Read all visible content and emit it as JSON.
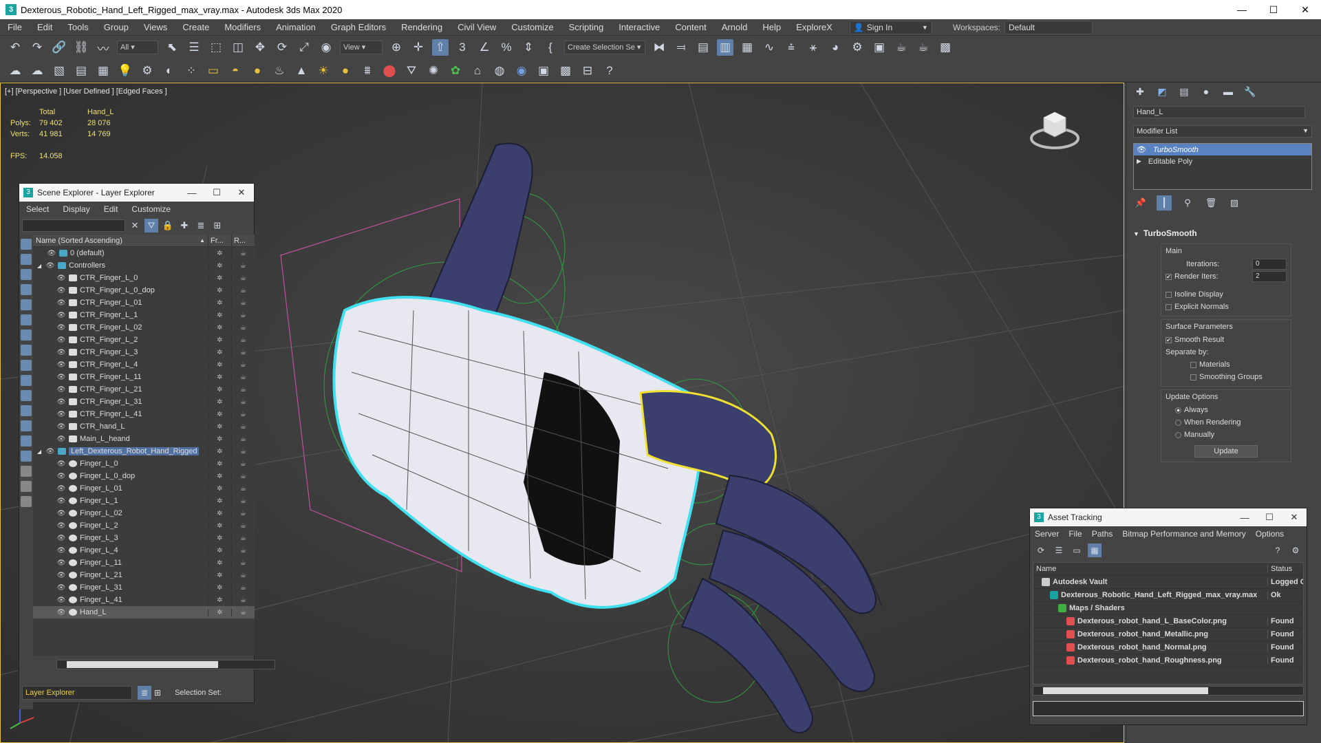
{
  "window": {
    "title": "Dexterous_Robotic_Hand_Left_Rigged_max_vray.max - Autodesk 3ds Max 2020",
    "minimize": "—",
    "maximize": "☐",
    "close": "✕"
  },
  "menubar": {
    "items": [
      "File",
      "Edit",
      "Tools",
      "Group",
      "Views",
      "Create",
      "Modifiers",
      "Animation",
      "Graph Editors",
      "Rendering",
      "Civil View",
      "Customize",
      "Scripting",
      "Interactive",
      "Content",
      "Arnold",
      "Help",
      "ExploreX"
    ],
    "sign_in": "Sign In",
    "workspaces_label": "Workspaces:",
    "workspace_value": "Default"
  },
  "toolbar1": {
    "selection_filter": "All",
    "ref_coord": "View",
    "create_selection_set": "Create Selection Se"
  },
  "viewport": {
    "label": "[+] [Perspective ] [User Defined ] [Edged Faces ]",
    "stats": {
      "col_total": "Total",
      "col_object": "Hand_L",
      "polys_label": "Polys:",
      "polys_total": "79 402",
      "polys_object": "28 076",
      "verts_label": "Verts:",
      "verts_total": "41 981",
      "verts_object": "14 769",
      "fps_label": "FPS:",
      "fps_value": "14.058"
    }
  },
  "scene_explorer": {
    "title": "Scene Explorer - Layer Explorer",
    "menu": [
      "Select",
      "Display",
      "Edit",
      "Customize"
    ],
    "columns": {
      "name": "Name (Sorted Ascending)",
      "freeze": "Fr...",
      "render": "R..."
    },
    "rows": [
      {
        "label": "0 (default)",
        "indent": 1,
        "kind": "layer"
      },
      {
        "label": "Controllers",
        "indent": 0,
        "kind": "group"
      },
      {
        "label": "CTR_Finger_L_0",
        "indent": 2,
        "kind": "ctrl"
      },
      {
        "label": "CTR_Finger_L_0_dop",
        "indent": 2,
        "kind": "ctrl"
      },
      {
        "label": "CTR_Finger_L_01",
        "indent": 2,
        "kind": "ctrl"
      },
      {
        "label": "CTR_Finger_L_1",
        "indent": 2,
        "kind": "ctrl"
      },
      {
        "label": "CTR_Finger_L_02",
        "indent": 2,
        "kind": "ctrl"
      },
      {
        "label": "CTR_Finger_L_2",
        "indent": 2,
        "kind": "ctrl"
      },
      {
        "label": "CTR_Finger_L_3",
        "indent": 2,
        "kind": "ctrl"
      },
      {
        "label": "CTR_Finger_L_4",
        "indent": 2,
        "kind": "ctrl"
      },
      {
        "label": "CTR_Finger_L_11",
        "indent": 2,
        "kind": "ctrl"
      },
      {
        "label": "CTR_Finger_L_21",
        "indent": 2,
        "kind": "ctrl"
      },
      {
        "label": "CTR_Finger_L_31",
        "indent": 2,
        "kind": "ctrl"
      },
      {
        "label": "CTR_Finger_L_41",
        "indent": 2,
        "kind": "ctrl"
      },
      {
        "label": "CTR_hand_L",
        "indent": 2,
        "kind": "ctrl"
      },
      {
        "label": "Main_L_heand",
        "indent": 2,
        "kind": "ctrl"
      },
      {
        "label": "Left_Dexterous_Robot_Hand_Rigged",
        "indent": 0,
        "kind": "selgroup"
      },
      {
        "label": "Finger_L_0",
        "indent": 2,
        "kind": "mesh"
      },
      {
        "label": "Finger_L_0_dop",
        "indent": 2,
        "kind": "mesh"
      },
      {
        "label": "Finger_L_01",
        "indent": 2,
        "kind": "mesh"
      },
      {
        "label": "Finger_L_1",
        "indent": 2,
        "kind": "mesh"
      },
      {
        "label": "Finger_L_02",
        "indent": 2,
        "kind": "mesh"
      },
      {
        "label": "Finger_L_2",
        "indent": 2,
        "kind": "mesh"
      },
      {
        "label": "Finger_L_3",
        "indent": 2,
        "kind": "mesh"
      },
      {
        "label": "Finger_L_4",
        "indent": 2,
        "kind": "mesh"
      },
      {
        "label": "Finger_L_11",
        "indent": 2,
        "kind": "mesh"
      },
      {
        "label": "Finger_L_21",
        "indent": 2,
        "kind": "mesh"
      },
      {
        "label": "Finger_L_31",
        "indent": 2,
        "kind": "mesh"
      },
      {
        "label": "Finger_L_41",
        "indent": 2,
        "kind": "mesh"
      },
      {
        "label": "Hand_L",
        "indent": 2,
        "kind": "mesh-sel"
      }
    ],
    "footer_explorer": "Layer Explorer",
    "selection_set_label": "Selection Set:"
  },
  "command_panel": {
    "object_name": "Hand_L",
    "modifier_list": "Modifier List",
    "stack": [
      "TurboSmooth",
      "Editable Poly"
    ],
    "rollout_title": "TurboSmooth",
    "main_label": "Main",
    "iterations_label": "Iterations:",
    "iterations_value": "0",
    "render_iters_label": "Render Iters:",
    "render_iters_value": "2",
    "isoline_label": "Isoline Display",
    "explicit_normals_label": "Explicit Normals",
    "surface_params_label": "Surface Parameters",
    "smooth_result_label": "Smooth Result",
    "separate_by_label": "Separate by:",
    "materials_label": "Materials",
    "smoothing_groups_label": "Smoothing Groups",
    "update_options_label": "Update Options",
    "always_label": "Always",
    "when_rendering_label": "When Rendering",
    "manually_label": "Manually",
    "update_button": "Update"
  },
  "asset_tracking": {
    "title": "Asset Tracking",
    "menu": [
      "Server",
      "File",
      "Paths",
      "Bitmap Performance and Memory",
      "Options"
    ],
    "columns": {
      "name": "Name",
      "status": "Status"
    },
    "rows": [
      {
        "name": "Autodesk Vault",
        "status": "Logged C",
        "indent": 1,
        "icon": "vault"
      },
      {
        "name": "Dexterous_Robotic_Hand_Left_Rigged_max_vray.max",
        "status": "Ok",
        "indent": 2,
        "icon": "max"
      },
      {
        "name": "Maps / Shaders",
        "status": "",
        "indent": 3,
        "icon": "maps"
      },
      {
        "name": "Dexterous_robot_hand_L_BaseColor.png",
        "status": "Found",
        "indent": 4,
        "icon": "png"
      },
      {
        "name": "Dexterous_robot_hand_Metallic.png",
        "status": "Found",
        "indent": 4,
        "icon": "png"
      },
      {
        "name": "Dexterous_robot_hand_Normal.png",
        "status": "Found",
        "indent": 4,
        "icon": "png"
      },
      {
        "name": "Dexterous_robot_hand_Roughness.png",
        "status": "Found",
        "indent": 4,
        "icon": "png"
      }
    ]
  },
  "colors": {
    "viewport_border": "#e6c040",
    "stats_text": "#f0e070",
    "selection_outline": "#40e0f0",
    "subselection_outline": "#f0e030",
    "hand_mesh": "#3a3f6e",
    "highlight": "#5f80a8"
  }
}
